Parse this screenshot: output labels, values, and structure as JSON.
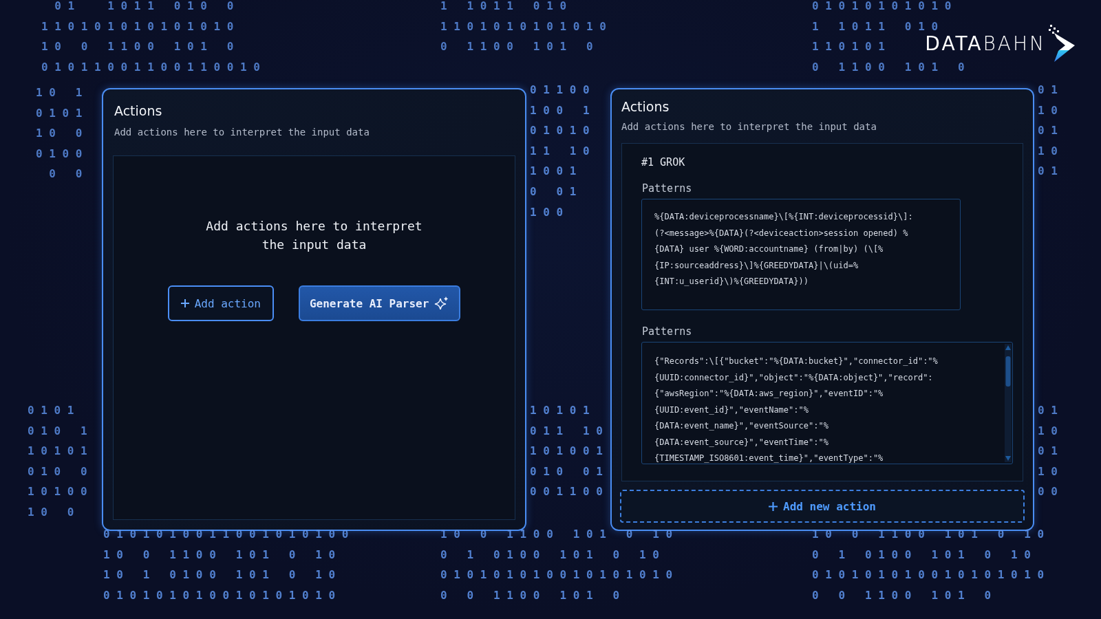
{
  "background_digits": [
    {
      "rows": [
        "  0 1     1 0 1 1   0 1 0   0",
        "1 1 0 1 0 1 0 1 0 1 0 1 0 1 0",
        "1 0   0   1 1 0 0   1 0 1   0",
        "0 1 0 1 1 0 0 1 1 0 0 1 1 0 0 1 0"
      ]
    },
    {
      "rows": [
        "1 0   1",
        "0 1 0 1",
        "1 0   0",
        "0 1 0 0",
        "  0   0"
      ]
    },
    {
      "rows": [
        "1   1 0 1 1   0 1 0",
        "1 1 0 1 0 1 0 1 0 1 0 1 0",
        "0   1 1 0 0   1 0 1   0"
      ]
    },
    {
      "rows": [
        "0 1 1 0 0",
        "1 0 0   1",
        "0 1 0 1 0",
        "1 1   1 0",
        "1 0 0 1",
        "0   0 1",
        "1 0 0"
      ]
    },
    {
      "rows": [
        "0 1 0 1 0 1 0 1 0 1 0",
        "1   1 0 1 1   0 1 0",
        "1 1 0 1 0 1",
        "0   1 1 0 0   1 0 1   0"
      ]
    },
    {
      "rows": [
        "0 1",
        "1 0",
        "0 1",
        "1 0",
        "0 1"
      ]
    },
    {
      "rows": [
        "0 1 0 1",
        "0 1 0   1",
        "1 0 1 0 1",
        "0 1 0   0",
        "1 0 1 0 0",
        "1 0   0"
      ]
    },
    {
      "rows": [
        "0 1 0 1 0 1 0 0 1 1 0 0 1 0 1 0 1 0 0",
        "1 0   0   1 1 0 0   1 0 1   0   1 0",
        "1 0   1   0 1 0 0   1 0 1   0   1 0",
        "0 1 0 1 0 1 0 1 0 0 1 0 1 0 1 0 1 0"
      ]
    },
    {
      "rows": [
        "1 0 1 0 1",
        "0 1 1   1 0",
        "1 0 1 0 0 1",
        "0 1 0   0 1",
        "0 0 1 1 0 0"
      ]
    },
    {
      "rows": [
        "1 0   0   1 1 0 0   1 0 1   0   1 0",
        "0   1   0 1 0 0   1 0 1   0   1 0",
        "0 1 0 1 0 1 0 1 0 0 1 0 1 0 1 0 1 0",
        "0   0   1 1 0 0   1 0 1   0"
      ]
    },
    {
      "rows": [
        "1 0   0   1 1 0 0   1 0 1   0   1 0",
        "0   1   0 1 0 0   1 0 1   0   1 0",
        "0 1 0 1 0 1 0 1 0 0 1 0 1 0 1 0 1 0",
        "0   0   1 1 0 0   1 0 1   0"
      ]
    },
    {
      "rows": [
        "0 1",
        "1 0",
        "0 1",
        "1 0",
        "0 0"
      ]
    }
  ],
  "logo": {
    "text": "**DATA**BAHN"
  },
  "left_panel": {
    "title": "Actions",
    "description": "Add actions here to interpret the input data",
    "empty_state": {
      "message": "Add actions here to interpret the input data",
      "buttons": [
        {
          "kind": "add",
          "label": "Add action"
        },
        {
          "kind": "generate",
          "label": "Generate AI Parser"
        }
      ]
    }
  },
  "right_panel": {
    "title": "Actions",
    "description": "Add actions here to interpret the input data",
    "action": {
      "title": "#1 GROK",
      "pattern_fields": [
        {
          "label": "Patterns",
          "scrollable": false,
          "lines": [
            "%{DATA:deviceprocessname}\\[%{INT:deviceprocessid}\\]:",
            "(?<message>%{DATA}(?<deviceaction>session opened) %",
            "{DATA} user %{WORD:accountname} (from|by) (\\[%",
            "{IP:sourceaddress}\\]%{GREEDYDATA}|\\(uid=%",
            "{INT:u_userid}\\)%{GREEDYDATA}))"
          ]
        },
        {
          "label": "Patterns",
          "scrollable": true,
          "lines": [
            "{\"Records\":\\[{\"bucket\":\"%{DATA:bucket}\",\"connector_id\":\"%",
            "{UUID:connector_id}\",\"object\":\"%{DATA:object}\",\"record\":",
            "{\"awsRegion\":\"%{DATA:aws_region}\",\"eventID\":\"%",
            "{UUID:event_id}\",\"eventName\":\"%",
            "{DATA:event_name}\",\"eventSource\":\"%",
            "{DATA:event_source}\",\"eventTime\":\"%",
            "{TIMESTAMP_ISO8601:event_time}\",\"eventType\":\"%"
          ]
        }
      ]
    },
    "add_button": {
      "label": "Add new action"
    }
  }
}
